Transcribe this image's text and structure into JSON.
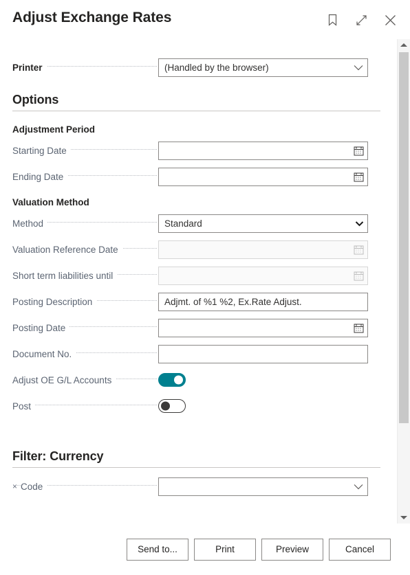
{
  "window": {
    "title": "Adjust Exchange Rates",
    "actions": [
      {
        "name": "bookmark-icon",
        "label": "Bookmark"
      },
      {
        "name": "expand-icon",
        "label": "Expand"
      },
      {
        "name": "close-icon",
        "label": "Close"
      }
    ]
  },
  "printer": {
    "label": "Printer",
    "value": "(Handled by the browser)"
  },
  "options": {
    "heading": "Options",
    "adjustment_period": {
      "group_title": "Adjustment Period",
      "starting_date": {
        "label": "Starting Date",
        "value": ""
      },
      "ending_date": {
        "label": "Ending Date",
        "value": ""
      }
    },
    "valuation_method": {
      "group_title": "Valuation Method",
      "method": {
        "label": "Method",
        "value": "Standard"
      },
      "valuation_reference_date": {
        "label": "Valuation Reference Date",
        "value": ""
      },
      "short_term_liabilities_until": {
        "label": "Short term liabilities until",
        "value": ""
      }
    },
    "posting_description": {
      "label": "Posting Description",
      "value": "Adjmt. of %1 %2, Ex.Rate Adjust."
    },
    "posting_date": {
      "label": "Posting Date",
      "value": ""
    },
    "document_no": {
      "label": "Document No.",
      "value": ""
    },
    "adjust_oe_gl_accounts": {
      "label": "Adjust OE G/L Accounts",
      "state": "on"
    },
    "post": {
      "label": "Post",
      "state": "off"
    }
  },
  "filter": {
    "heading": "Filter: Currency",
    "code": {
      "label": "Code",
      "value": "",
      "remove_glyph": "×"
    }
  },
  "footer": {
    "send_to": "Send to...",
    "print": "Print",
    "preview": "Preview",
    "cancel": "Cancel"
  },
  "colors": {
    "accent_teal": "#00808f",
    "title_text": "#252423",
    "label_text": "#5b6472",
    "border": "#8a8886"
  }
}
